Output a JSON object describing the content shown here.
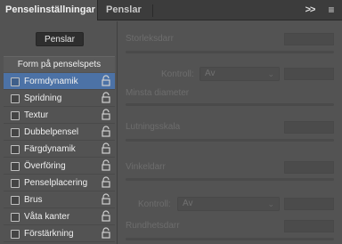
{
  "tabs": {
    "active": "Penselinställningar",
    "inactive": "Penslar",
    "collapse_glyph": ">>",
    "menu_glyph": "≡"
  },
  "left": {
    "penslar_button": "Penslar",
    "section_header": "Form på penselspets",
    "options": [
      {
        "label": "Formdynamik",
        "checked": false,
        "selected": true
      },
      {
        "label": "Spridning",
        "checked": false,
        "selected": false
      },
      {
        "label": "Textur",
        "checked": false,
        "selected": false
      },
      {
        "label": "Dubbelpensel",
        "checked": false,
        "selected": false
      },
      {
        "label": "Färgdynamik",
        "checked": false,
        "selected": false
      },
      {
        "label": "Överföring",
        "checked": false,
        "selected": false
      },
      {
        "label": "Penselplacering",
        "checked": false,
        "selected": false
      },
      {
        "label": "Brus",
        "checked": false,
        "selected": false
      },
      {
        "label": "Våta kanter",
        "checked": false,
        "selected": false
      },
      {
        "label": "Förstärkning",
        "checked": false,
        "selected": false
      }
    ]
  },
  "right": {
    "size_jitter": "Storleksdarr",
    "control1_label": "Kontroll:",
    "control1_value": "Av",
    "min_diameter": "Minsta diameter",
    "tilt_scale": "Lutningsskala",
    "angle_jitter": "Vinkeldarr",
    "control2_label": "Kontroll:",
    "control2_value": "Av",
    "roundness_jitter": "Rundhetsdarr"
  },
  "colors": {
    "panel_bg": "#535353",
    "tabbar_bg": "#3c3c3c",
    "selected_row": "#4c72a6",
    "disabled_text": "#6d6d6d"
  }
}
